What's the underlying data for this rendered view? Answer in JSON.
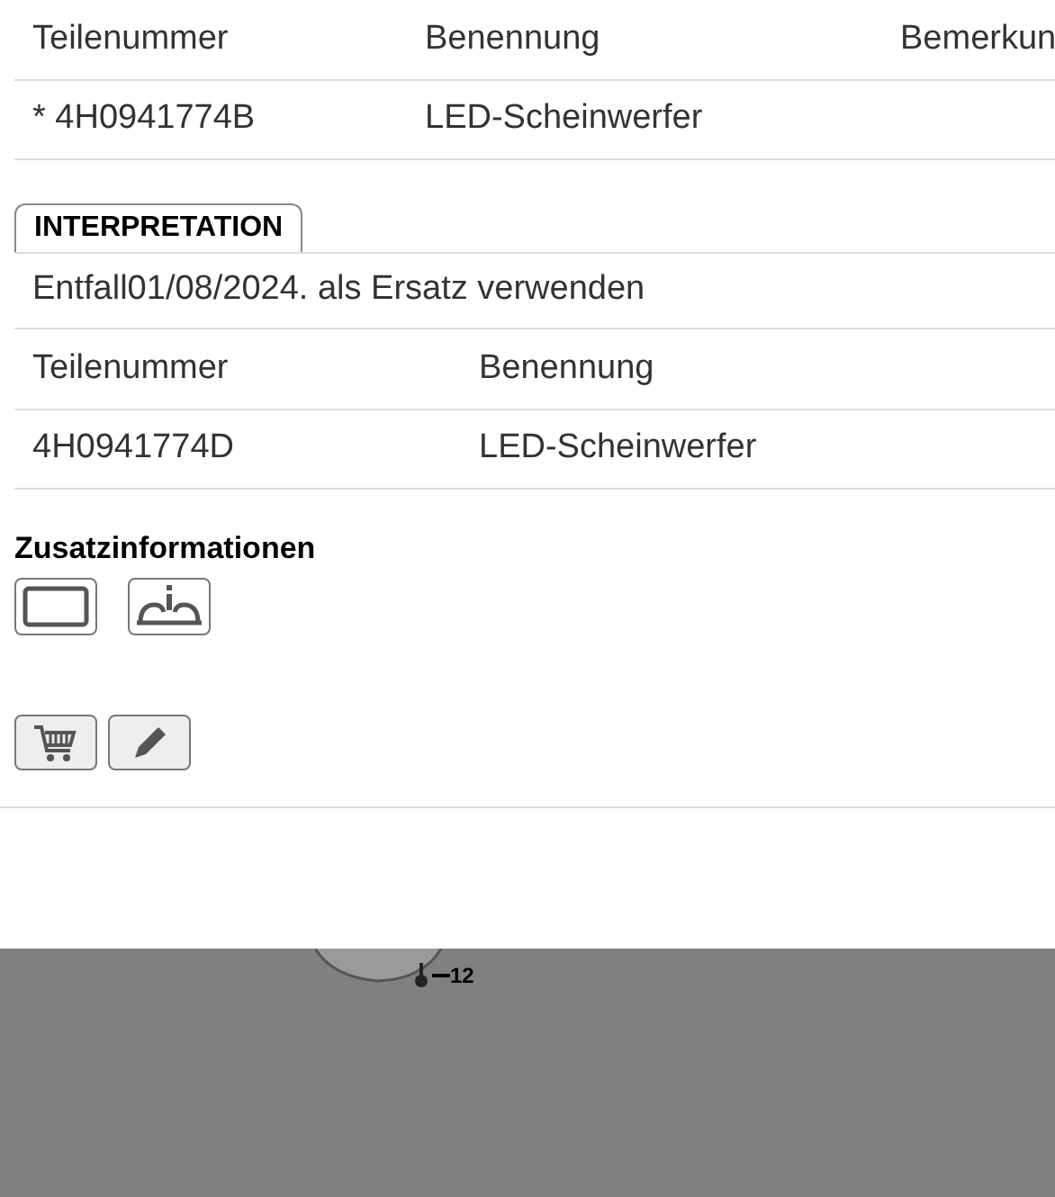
{
  "table_1": {
    "columns": [
      "Teilenummer",
      "Benennung",
      "Bemerkun"
    ],
    "rows": [
      [
        "* 4H0941774B",
        "LED-Scheinwerfer",
        ""
      ]
    ]
  },
  "interpretation": {
    "tab": "INTERPRETATION",
    "note": "Entfall01/08/2024. als Ersatz verwenden",
    "columns": [
      "Teilenummer",
      "Benennung"
    ],
    "rows": [
      [
        "4H0941774D",
        "LED-Scheinwerfer"
      ]
    ]
  },
  "additional_info": {
    "title": "Zusatzinformationen"
  },
  "drawing": {
    "callouts": [
      "12"
    ]
  }
}
